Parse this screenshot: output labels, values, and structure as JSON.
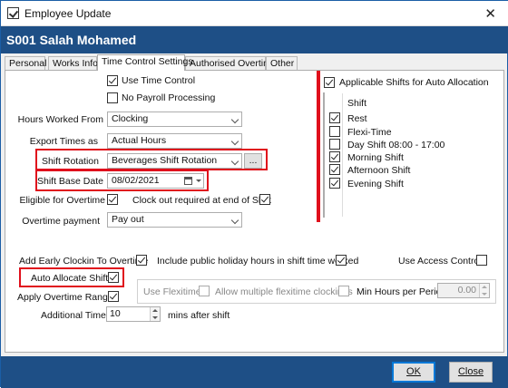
{
  "window": {
    "title": "Employee Update",
    "close": "✕"
  },
  "header": {
    "employee": "S001 Salah Mohamed"
  },
  "tabs": [
    "Personal",
    "Works Info",
    "Time Control Settings",
    "Authorised Overtime",
    "Other"
  ],
  "form": {
    "use_time_control": "Use Time Control",
    "no_payroll": "No Payroll Processing",
    "hours_worked_from_label": "Hours Worked From",
    "hours_worked_from_value": "Clocking",
    "export_times_label": "Export Times as",
    "export_times_value": "Actual Hours",
    "shift_rotation_label": "Shift Rotation",
    "shift_rotation_value": "Beverages Shift Rotation",
    "ellipsis": "...",
    "shift_base_date_label": "Shift Base Date",
    "shift_base_date_value": "08/02/2021",
    "eligible_overtime": "Eligible for Overtime",
    "clock_out_required": "Clock out required at end of Shift",
    "overtime_payment_label": "Overtime payment",
    "overtime_payment_value": "Pay out",
    "add_early_clockin": "Add Early Clockin To Overtime",
    "include_public_holiday": "Include public holiday hours in shift time worked",
    "use_access_control": "Use Access Control",
    "auto_allocate": "Auto Allocate Shifts",
    "apply_overtime_ranges": "Apply Overtime Ranges",
    "use_flexitime": "Use Flexitime",
    "allow_multiple_flexitime": "Allow multiple flexitime clockings",
    "min_hours_label": "Min Hours per Period",
    "min_hours_value": "0.00",
    "additional_time_label": "Additional Time",
    "additional_time_value": "10",
    "mins_after_shift": "mins after shift"
  },
  "shifts_panel": {
    "header": "Applicable Shifts for Auto Allocation",
    "column": "Shift",
    "items": [
      {
        "name": "Rest",
        "checked": true
      },
      {
        "name": "Flexi-Time",
        "checked": false
      },
      {
        "name": "Day Shift 08:00 - 17:00",
        "checked": false
      },
      {
        "name": "Morning Shift",
        "checked": true
      },
      {
        "name": "Afternoon Shift",
        "checked": true
      },
      {
        "name": "Evening Shift",
        "checked": true
      }
    ]
  },
  "footer": {
    "ok": "OK",
    "close": "Close"
  },
  "colors": {
    "header_bg": "#1e4f86",
    "highlight": "#e0101c"
  }
}
